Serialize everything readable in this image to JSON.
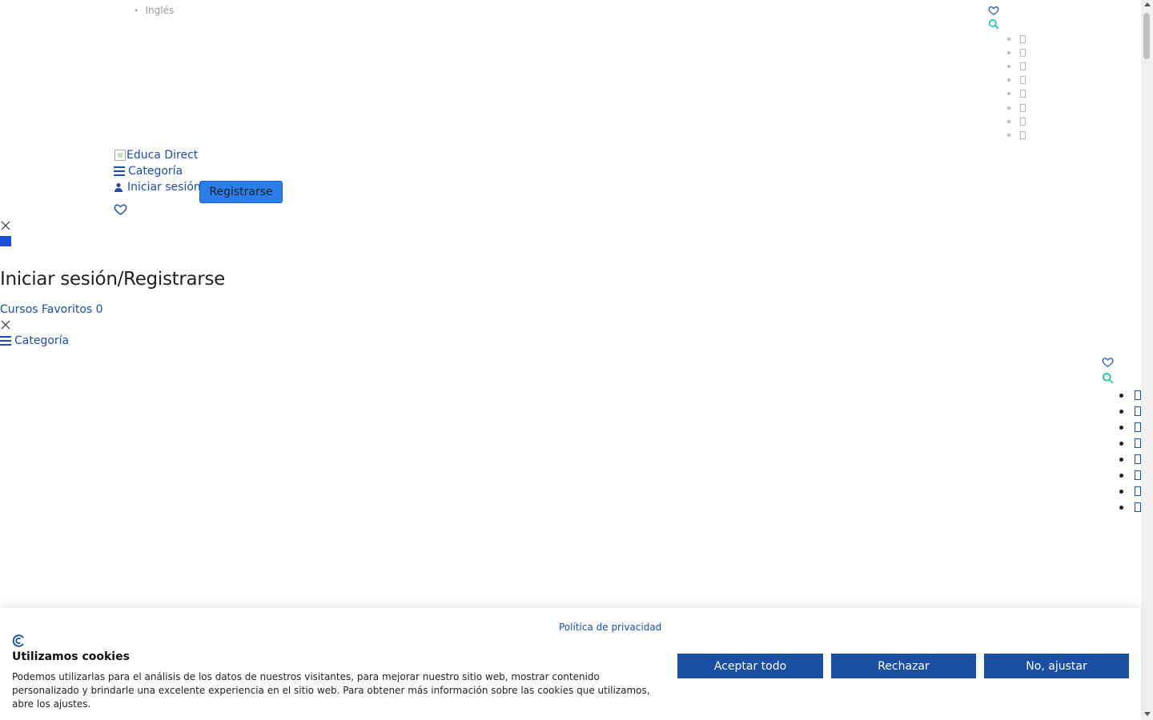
{
  "top": {
    "language": "Inglés",
    "social_links_count": 8
  },
  "header": {
    "logo_alt": "Educa Direct",
    "category_label": "Categoría",
    "login_label": "Iniciar sesión",
    "register_label": "Registrarse"
  },
  "panel": {
    "title": "Iniciar sesión/Registrarse",
    "favorites_label": "Cursos Favoritos",
    "favorites_count": "0",
    "category_label": "Categoría"
  },
  "cookie_banner": {
    "policy_link": "Política de privacidad",
    "title": "Utilizamos cookies",
    "text": "Podemos utilizarlas para el análisis de los datos de nuestros visitantes, para mejorar nuestro sitio web, mostrar contenido personalizado y brindarle una excelente experiencia en el sitio web. Para obtener más información sobre las cookies que utilizamos, abre los ajustes.",
    "accept_all": "Aceptar todo",
    "reject": "Rechazar",
    "adjust": "No, ajustar"
  },
  "colors": {
    "link": "#1a4fa3",
    "register_button": "#2b7de9",
    "cookie_button": "#1a4fa3",
    "search_icon": "#2ec4a6"
  }
}
